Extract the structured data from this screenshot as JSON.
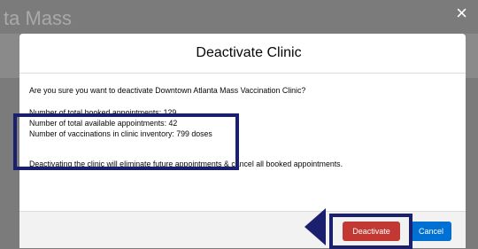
{
  "background": {
    "title_fragment": "ta Mass"
  },
  "dialog": {
    "close_icon": "×",
    "title": "Deactivate Clinic",
    "question": "Are you sure you want to deactivate Downtown Atlanta Mass Vaccination Clinic?",
    "stats": {
      "booked": "Number of total booked appointments: 129",
      "available": "Number of total available appointments: 42",
      "inventory": "Number of vaccinations in clinic inventory: 799 doses"
    },
    "note": "Deactivating the clinic will eliminate future appointments & cancel all booked appointments.",
    "buttons": {
      "deactivate": "Deactivate",
      "cancel": "Cancel"
    }
  },
  "colors": {
    "annotation": "#1a1f6e",
    "destructive": "#c23934",
    "brand": "#0070d2"
  },
  "icons": {
    "close": "close-icon",
    "annotation_arrow": "arrow-left-icon"
  }
}
